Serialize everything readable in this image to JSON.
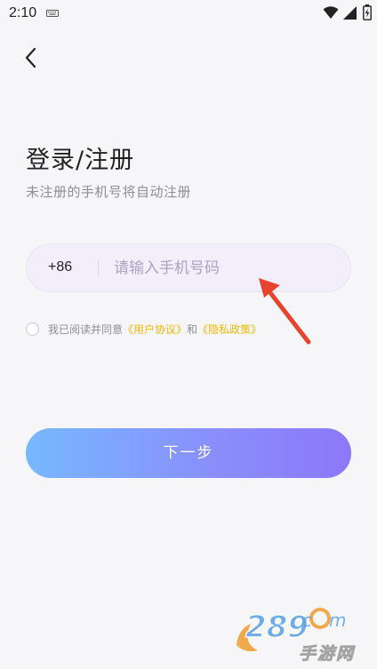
{
  "status_bar": {
    "time": "2:10",
    "icons": [
      "keyboard-icon",
      "wifi-icon",
      "signal-icon",
      "battery-icon"
    ]
  },
  "header": {
    "back_icon": "back-chevron-icon"
  },
  "login": {
    "title": "登录/注册",
    "subtitle": "未注册的手机号将自动注册",
    "country_code": "+86",
    "phone_placeholder": "请输入手机号码",
    "phone_value": ""
  },
  "agreement": {
    "checked": false,
    "prefix": "我已阅读并同意",
    "user_agreement": "《用户协议》",
    "conjunction": "和",
    "privacy_policy": "《隐私政策》"
  },
  "actions": {
    "next_label": "下一步"
  },
  "watermark": {
    "brand": "289 com",
    "subtitle": "手游网"
  },
  "colors": {
    "background": "#f6f6f8",
    "accent_link": "#f5b800",
    "button_gradient_start": "#77b8ff",
    "button_gradient_end": "#8c78f8",
    "annotation_arrow": "#e8432e"
  }
}
